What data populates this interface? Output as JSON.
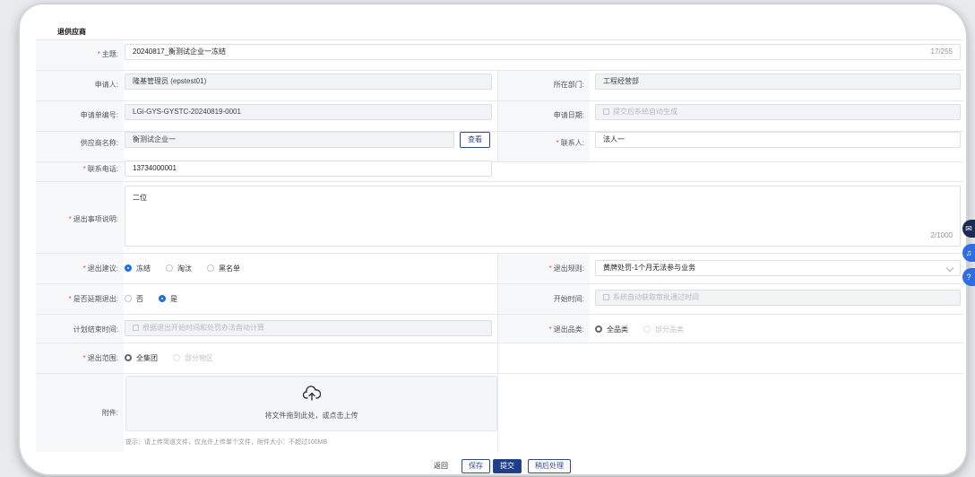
{
  "page": {
    "title": "退供应商"
  },
  "form": {
    "subject": {
      "label": "主题:",
      "value": "20240817_衡测试企业一冻结",
      "counter": "17/255"
    },
    "applicant": {
      "label": "申请人:",
      "value": "隆基管理员 (epstest01)"
    },
    "department": {
      "label": "所在部门:",
      "value": "工程经营部"
    },
    "app_no": {
      "label": "申请单编号:",
      "value": "LGi-GYS-GYSTC-20240819-0001"
    },
    "app_date": {
      "label": "申请日期:",
      "placeholder": "提交后系统自动生成"
    },
    "supplier": {
      "label": "供应商名称:",
      "value": "衡测试企业一",
      "view_label": "查看"
    },
    "contact": {
      "label": "联系人:",
      "value": "法人一"
    },
    "phone": {
      "label": "联系电话:",
      "value": "13734000001"
    },
    "exit_desc": {
      "label": "退出事项说明:",
      "value": "二位",
      "counter": "2/1000"
    },
    "exit_suggest": {
      "label": "退出建议:",
      "options": [
        "冻结",
        "淘汰",
        "黑名单"
      ],
      "selected": "冻结"
    },
    "exit_rule": {
      "label": "退出规则:",
      "value": "黄牌处罚-1个月无法参与业务"
    },
    "extend": {
      "label": "是否延期退出:",
      "options": [
        "否",
        "是"
      ],
      "selected": "是"
    },
    "start_time": {
      "label": "开始时间:",
      "placeholder": "系统自动获取审批通过时间"
    },
    "plan_end": {
      "label": "计划结束时间:",
      "placeholder": "根据退出开始时间和处罚办法自动计算"
    },
    "exit_category": {
      "label": "退出品类:",
      "options": [
        "全品类",
        "部分品类"
      ],
      "selected": "全品类"
    },
    "exit_scope": {
      "label": "退出范围:",
      "options": [
        "全集团",
        "部分物区"
      ],
      "selected": "全集团"
    },
    "attachment": {
      "label": "附件:",
      "upload_text": "将文件拖到此处，或点击上传",
      "hint": "提示：请上传简道文件，仅允许上传单个文件，附件大小：不超过100MB"
    }
  },
  "footer": {
    "back": "返回",
    "save": "保存",
    "submit": "提交",
    "later": "稍后处理"
  },
  "side": {
    "btn1": "✉",
    "btn2": "♫",
    "btn3": "?"
  },
  "colors": {
    "primary": "#1f3e8a",
    "radio_on": "#1d6fe8",
    "required": "#f04848"
  }
}
